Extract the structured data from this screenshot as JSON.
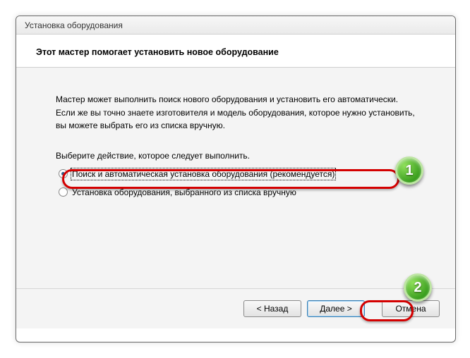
{
  "window": {
    "title": "Установка оборудования"
  },
  "header": {
    "title": "Этот мастер помогает установить новое оборудование"
  },
  "body": {
    "description": "Мастер может выполнить поиск нового оборудования и установить его автоматически. Если же вы точно знаете изготовителя и модель оборудования, которое нужно установить, вы можете выбрать его из списка вручную.",
    "prompt": "Выберите действие, которое следует выполнить.",
    "options": [
      {
        "label": "Поиск и автоматическая установка оборудования (рекомендуется)",
        "checked": true,
        "focused": true
      },
      {
        "label": "Установка оборудования, выбранного из списка вручную",
        "checked": false,
        "focused": false
      }
    ]
  },
  "footer": {
    "back": "< Назад",
    "next": "Далее >",
    "cancel": "Отмена"
  },
  "annotations": {
    "badge1": "1",
    "badge2": "2"
  }
}
